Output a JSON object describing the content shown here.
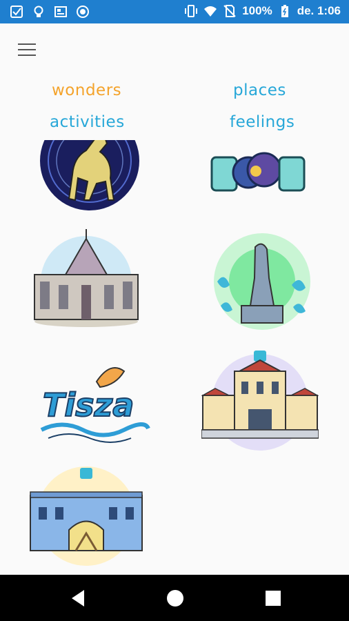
{
  "status_bar": {
    "battery": "100%",
    "time": "de. 1:06",
    "left_icons": [
      "checkbox-icon",
      "lightbulb-icon",
      "news-icon",
      "circle-icon"
    ],
    "right_icons": [
      "vibrate-icon",
      "wifi-icon",
      "no-sim-icon",
      "battery-icon"
    ]
  },
  "tabs": [
    {
      "label": "wonders",
      "color": "#f4a32b",
      "active": true
    },
    {
      "label": "places",
      "color": "#27a7d8",
      "active": false
    },
    {
      "label": "activities",
      "color": "#27a7d8",
      "active": false
    },
    {
      "label": "feelings",
      "color": "#27a7d8",
      "active": false
    }
  ],
  "cards": [
    {
      "name": "deer-constellation-card"
    },
    {
      "name": "rock-flower-card"
    },
    {
      "name": "cathedral-card"
    },
    {
      "name": "fountain-statue-card"
    },
    {
      "name": "tisza-card",
      "text": "Tisza"
    },
    {
      "name": "palace-card"
    },
    {
      "name": "blue-building-card"
    }
  ],
  "nav": {
    "icons": [
      "back-icon",
      "home-icon",
      "recents-icon"
    ]
  }
}
